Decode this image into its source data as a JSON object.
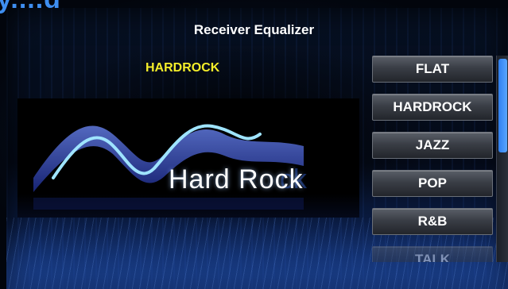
{
  "header": {
    "corner_text": "y....g",
    "title": "Receiver Equalizer"
  },
  "current_preset": "HARDROCK",
  "artwork": {
    "text": "Hard Rock"
  },
  "presets": [
    {
      "label": "FLAT"
    },
    {
      "label": "HARDROCK"
    },
    {
      "label": "JAZZ"
    },
    {
      "label": "POP"
    },
    {
      "label": "R&B"
    },
    {
      "label": "TALK"
    }
  ],
  "scrollbar": {
    "position_fraction": 0.0,
    "visible_fraction": 0.45
  },
  "colors": {
    "accent": "#3e8ef0",
    "preset_label": "#f5ee2a",
    "scroll_thumb": "#2f7ff0"
  }
}
